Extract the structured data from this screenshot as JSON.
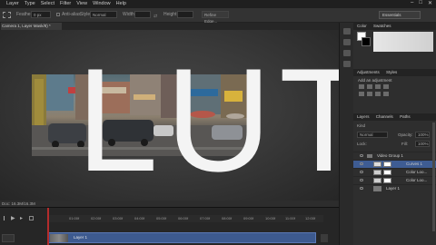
{
  "menubar": {
    "items": [
      "Layer",
      "Type",
      "Select",
      "Filter",
      "View",
      "Window",
      "Help"
    ],
    "win_controls": [
      "–",
      "□",
      "✕"
    ]
  },
  "options": {
    "feather_label": "Feather:",
    "feather_value": "0 px",
    "antialias_label": "Anti-alias",
    "style_label": "Style:",
    "style_value": "Normal",
    "width_label": "Width:",
    "height_label": "Height:",
    "refine_edge_label": "Refine Edge...",
    "workspace": "Essentials"
  },
  "document": {
    "tab_title": "Camera 1, Layer Mask/8) *",
    "status_text": "Doc: 16.3M/16.3M"
  },
  "overlay_text": "LUT",
  "timeline": {
    "ticks": [
      "01:00f",
      "02:00f",
      "03:00f",
      "04:00f",
      "05:00f",
      "06:00f",
      "07:00f",
      "08:00f",
      "09:00f",
      "10:00f",
      "11:00f",
      "12:00f"
    ],
    "clip_label": "Layer 1"
  },
  "panels": {
    "color_tabs": [
      "Color",
      "Swatches"
    ],
    "adjust_tabs": [
      "Adjustments",
      "Styles"
    ],
    "adjust_hint": "Add an adjustment",
    "layers_tabs": [
      "Layers",
      "Channels",
      "Paths"
    ],
    "kind_label": "Kind",
    "blend_mode": "Normal",
    "opacity_label": "Opacity:",
    "opacity_value": "100%",
    "lock_label": "Lock:",
    "fill_label": "Fill:",
    "fill_value": "100%",
    "layers": [
      {
        "name": "Video Group 1",
        "selected": false
      },
      {
        "name": "Curves 1",
        "selected": true
      },
      {
        "name": "Color Loo...",
        "selected": false
      },
      {
        "name": "Color Loo...",
        "selected": false
      },
      {
        "name": "Layer 1",
        "selected": false
      }
    ]
  },
  "colors": {
    "selection": "#3e5c93",
    "clip": "#3d5a8f",
    "playhead": "#b32c2c"
  }
}
